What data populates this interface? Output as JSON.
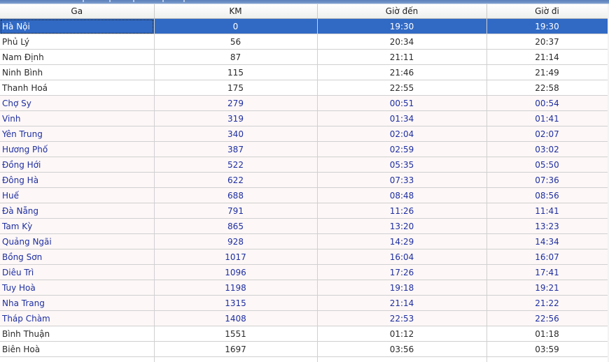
{
  "columns": [
    "Ga",
    "KM",
    "Giờ đến",
    "Giờ đi"
  ],
  "selected_index": 0,
  "colors": {
    "selection_bg": "#316ac5",
    "selection_fg": "#ffffff",
    "alt_text": "#1e2ea0",
    "default_text": "#2a2a2a"
  },
  "rows": [
    {
      "ga": "Hà Nội",
      "km": "0",
      "den": "19:30",
      "di": "19:30",
      "alt": false
    },
    {
      "ga": "Phủ Lý",
      "km": "56",
      "den": "20:34",
      "di": "20:37",
      "alt": false
    },
    {
      "ga": "Nam Định",
      "km": "87",
      "den": "21:11",
      "di": "21:14",
      "alt": false
    },
    {
      "ga": "Ninh Bình",
      "km": "115",
      "den": "21:46",
      "di": "21:49",
      "alt": false
    },
    {
      "ga": "Thanh Hoá",
      "km": "175",
      "den": "22:55",
      "di": "22:58",
      "alt": false
    },
    {
      "ga": "Chợ Sy",
      "km": "279",
      "den": "00:51",
      "di": "00:54",
      "alt": true
    },
    {
      "ga": "Vinh",
      "km": "319",
      "den": "01:34",
      "di": "01:41",
      "alt": true
    },
    {
      "ga": "Yên Trung",
      "km": "340",
      "den": "02:04",
      "di": "02:07",
      "alt": true
    },
    {
      "ga": "Hương Phố",
      "km": "387",
      "den": "02:59",
      "di": "03:02",
      "alt": true
    },
    {
      "ga": "Đồng Hới",
      "km": "522",
      "den": "05:35",
      "di": "05:50",
      "alt": true
    },
    {
      "ga": "Đông Hà",
      "km": "622",
      "den": "07:33",
      "di": "07:36",
      "alt": true
    },
    {
      "ga": "Huế",
      "km": "688",
      "den": "08:48",
      "di": "08:56",
      "alt": true
    },
    {
      "ga": "Đà Nẵng",
      "km": "791",
      "den": "11:26",
      "di": "11:41",
      "alt": true
    },
    {
      "ga": "Tam Kỳ",
      "km": "865",
      "den": "13:20",
      "di": "13:23",
      "alt": true
    },
    {
      "ga": "Quảng Ngãi",
      "km": "928",
      "den": "14:29",
      "di": "14:34",
      "alt": true
    },
    {
      "ga": "Bồng Sơn",
      "km": "1017",
      "den": "16:04",
      "di": "16:07",
      "alt": true
    },
    {
      "ga": "Diêu Trì",
      "km": "1096",
      "den": "17:26",
      "di": "17:41",
      "alt": true
    },
    {
      "ga": "Tuy Hoà",
      "km": "1198",
      "den": "19:18",
      "di": "19:21",
      "alt": true
    },
    {
      "ga": "Nha Trang",
      "km": "1315",
      "den": "21:14",
      "di": "21:22",
      "alt": true
    },
    {
      "ga": "Tháp Chàm",
      "km": "1408",
      "den": "22:53",
      "di": "22:56",
      "alt": true
    },
    {
      "ga": "Bình Thuận",
      "km": "1551",
      "den": "01:12",
      "di": "01:18",
      "alt": false
    },
    {
      "ga": "Biên Hoà",
      "km": "1697",
      "den": "03:56",
      "di": "03:59",
      "alt": false
    },
    {
      "ga": "",
      "km": "",
      "den": "",
      "di": "",
      "alt": false
    }
  ]
}
